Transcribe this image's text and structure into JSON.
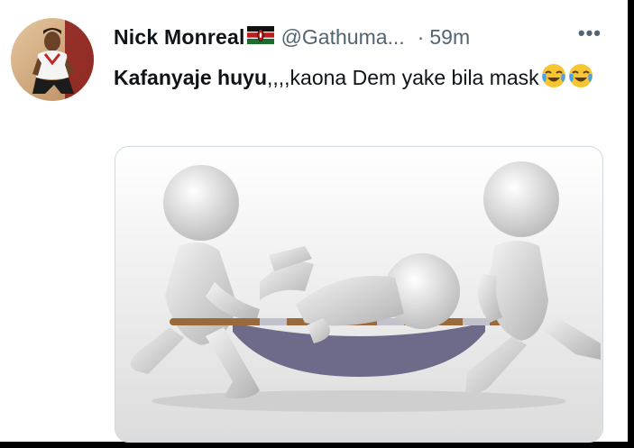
{
  "tweet": {
    "author_name": "Nick Monreal",
    "flag_icon": "kenya-flag-icon",
    "handle": "@Gathuma...",
    "separator": "·",
    "time": "59m",
    "more_label": "•••",
    "text_bold": "Kafanyaje huyu",
    "text_rest": ",,,,kaona Dem yake bila mask",
    "emoji_icons": [
      "face-with-tears-of-joy-icon",
      "face-with-tears-of-joy-icon"
    ]
  },
  "colors": {
    "text": "#0f1419",
    "secondary": "#536471",
    "border": "#cfd9de",
    "background": "#ffffff"
  }
}
